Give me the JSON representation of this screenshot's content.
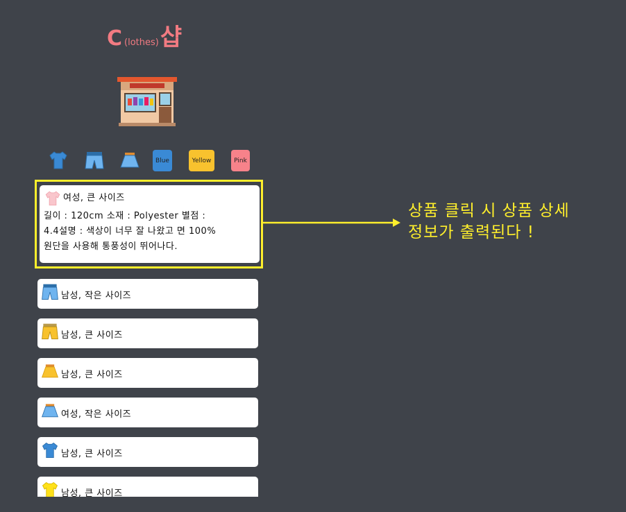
{
  "app": {
    "title_c": "C",
    "title_sub": "(lothes)",
    "title_korean": "샵"
  },
  "filters": {
    "icons": [
      "tshirt-icon",
      "shorts-icon",
      "skirt-icon"
    ],
    "colors": [
      {
        "label": "Blue",
        "color": "#3a8ad5"
      },
      {
        "label": "Yellow",
        "color": "#f8c22e"
      },
      {
        "label": "Pink",
        "color": "#f7828a"
      }
    ]
  },
  "detail": {
    "icon": "pink-tshirt-icon",
    "title": "여성, 큰 사이즈",
    "lines": [
      "길이 : 120cm 소재 : Polyester 별점 :",
      "4.4설명 : 색상이 너무 잘 나왔고 면 100%",
      "원단을 사용해 통풍성이 뛰어나다."
    ]
  },
  "items": [
    {
      "icon": "blue-shorts-icon",
      "label": "남성, 작은 사이즈"
    },
    {
      "icon": "yellow-shorts-icon",
      "label": "남성, 큰 사이즈"
    },
    {
      "icon": "yellow-skirt-icon",
      "label": "남성, 큰 사이즈"
    },
    {
      "icon": "blue-skirt-icon",
      "label": "여성, 작은 사이즈"
    },
    {
      "icon": "blue-tshirt-icon",
      "label": "남성, 큰 사이즈"
    },
    {
      "icon": "yellow-tshirt-icon",
      "label": "남성, 큰 사이즈"
    }
  ],
  "annotation": {
    "line1": "상품 클릭 시 상품 상세",
    "line2": "정보가 출력된다 !"
  },
  "colors": {
    "background": "#3f434a",
    "accent_yellow": "#ffef2c",
    "title_pink": "#f27b82"
  }
}
